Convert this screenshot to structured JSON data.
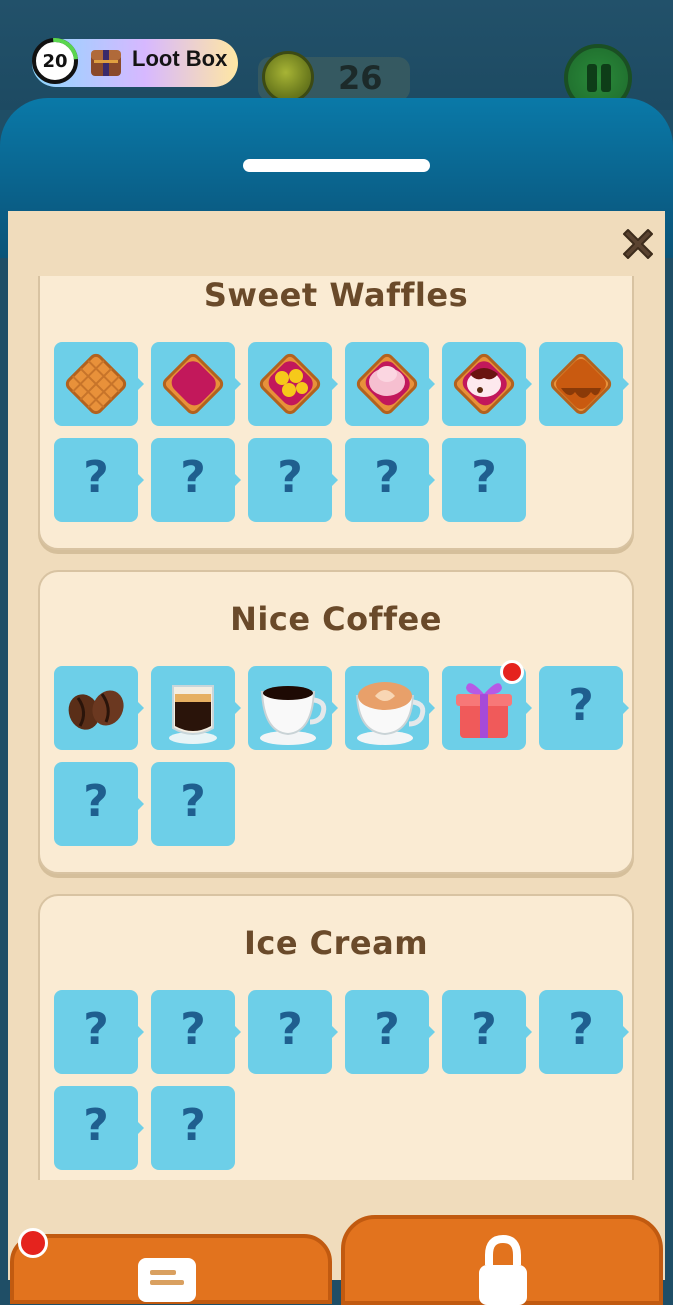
{
  "hud": {
    "level": "20",
    "loot_box_label": "Loot Box",
    "coins": "26"
  },
  "colors": {
    "tile": "#6dcfe8",
    "card_bg": "#faebd3",
    "sheet_header": "#0a6d99",
    "button_orange": "#e2731e",
    "notification_red": "#e5231e"
  },
  "sections": [
    {
      "title": "Sweet Waffles",
      "items": [
        {
          "state": "unlocked",
          "icon": "plain-waffle-icon"
        },
        {
          "state": "unlocked",
          "icon": "jam-waffle-icon"
        },
        {
          "state": "unlocked",
          "icon": "banana-waffle-icon"
        },
        {
          "state": "unlocked",
          "icon": "cream-waffle-icon"
        },
        {
          "state": "unlocked",
          "icon": "chocolate-cream-waffle-icon"
        },
        {
          "state": "unlocked",
          "icon": "caramel-waffle-icon"
        },
        {
          "state": "locked",
          "label": "?"
        },
        {
          "state": "locked",
          "label": "?"
        },
        {
          "state": "locked",
          "label": "?"
        },
        {
          "state": "locked",
          "label": "?"
        },
        {
          "state": "locked",
          "label": "?"
        }
      ]
    },
    {
      "title": "Nice Coffee",
      "items": [
        {
          "state": "unlocked",
          "icon": "coffee-beans-icon"
        },
        {
          "state": "unlocked",
          "icon": "espresso-glass-icon"
        },
        {
          "state": "unlocked",
          "icon": "black-coffee-cup-icon"
        },
        {
          "state": "unlocked",
          "icon": "latte-art-cup-icon"
        },
        {
          "state": "unlocked",
          "icon": "gift-box-icon",
          "notification": true
        },
        {
          "state": "locked",
          "label": "?"
        },
        {
          "state": "locked",
          "label": "?"
        },
        {
          "state": "locked",
          "label": "?"
        }
      ]
    },
    {
      "title": "Ice Cream",
      "items": [
        {
          "state": "locked",
          "label": "?"
        },
        {
          "state": "locked",
          "label": "?"
        },
        {
          "state": "locked",
          "label": "?"
        },
        {
          "state": "locked",
          "label": "?"
        },
        {
          "state": "locked",
          "label": "?"
        },
        {
          "state": "locked",
          "label": "?"
        },
        {
          "state": "locked",
          "label": "?"
        },
        {
          "state": "locked",
          "label": "?"
        }
      ]
    }
  ],
  "bottom_buttons": {
    "left": {
      "icon": "scroll-icon",
      "notification": true
    },
    "right": {
      "icon": "lock-icon"
    }
  }
}
